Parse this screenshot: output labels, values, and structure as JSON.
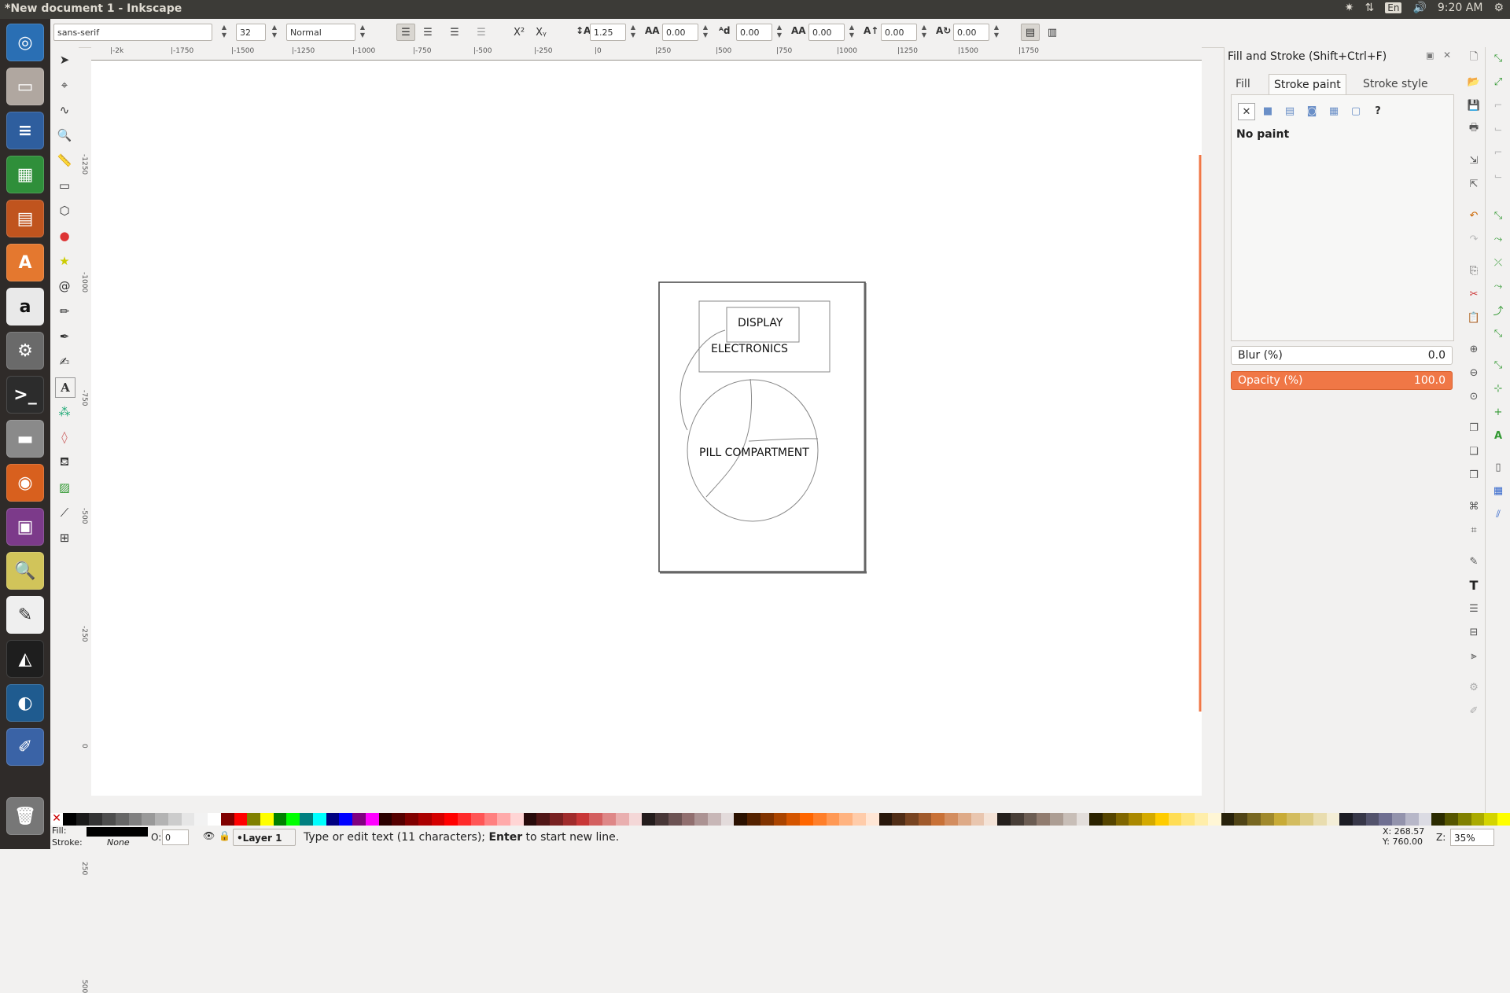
{
  "window": {
    "title": "*New document 1 - Inkscape"
  },
  "tray": {
    "lang": "En",
    "time": "9:20 AM"
  },
  "text_toolbar": {
    "font_family": "sans-serif",
    "font_size": "32",
    "font_style": "Normal",
    "line_spacing": "1.25",
    "letter_spacing": "0.00",
    "word_spacing": "0.00",
    "kerning": "0.00",
    "vertical_shift": "0.00",
    "rotation": "0.00"
  },
  "ruler_labels": [
    "-2k",
    "-1750",
    "-1500",
    "-1250",
    "-1000",
    "-750",
    "-500",
    "-250",
    "0",
    "250",
    "500",
    "750",
    "1000",
    "1250",
    "1500",
    "1750"
  ],
  "vruler_labels": [
    "-1250",
    "-1000",
    "-750",
    "-500",
    "-250",
    "0",
    "250",
    "500"
  ],
  "drawing": {
    "labels": {
      "display": "DISPLAY",
      "electronics": "ELECTRONICS",
      "pill": "PILL COMPARTMENT"
    }
  },
  "dialog": {
    "title": "Fill and Stroke (Shift+Ctrl+F)",
    "tabs": [
      "Fill",
      "Stroke paint",
      "Stroke style"
    ],
    "paint_status": "No paint",
    "blur_label": "Blur (%)",
    "blur_value": "0.0",
    "opacity_label": "Opacity (%)",
    "opacity_value": "100.0"
  },
  "status": {
    "fill_label": "Fill:",
    "stroke_label": "Stroke:",
    "stroke_value": "None",
    "opacity_label": "O:",
    "opacity_value": "0",
    "layer": "•Layer 1",
    "message_pre": "Type or edit text (11 characters); ",
    "message_bold": "Enter",
    "message_post": " to start new line.",
    "x": "X: 268.57",
    "y": "Y: 760.00",
    "zoom_label": "Z:",
    "zoom": "35%"
  },
  "colors": {
    "accent": "#f07746",
    "palette": [
      "#000000",
      "#1a1a1a",
      "#333333",
      "#4d4d4d",
      "#666666",
      "#808080",
      "#999999",
      "#b3b3b3",
      "#cccccc",
      "#e6e6e6",
      "#f2f2f2",
      "#ffffff",
      "#800000",
      "#ff0000",
      "#808000",
      "#ffff00",
      "#008000",
      "#00ff00",
      "#008080",
      "#00ffff",
      "#000080",
      "#0000ff",
      "#800080",
      "#ff00ff",
      "#2b0000",
      "#550000",
      "#800000",
      "#aa0000",
      "#d40000",
      "#ff0000",
      "#ff2a2a",
      "#ff5555",
      "#ff8080",
      "#ffaaaa",
      "#ffd5d5",
      "#280b0b",
      "#501616",
      "#782121",
      "#a02c2c",
      "#c83737",
      "#d35f5f",
      "#de8787",
      "#e9afaf",
      "#f4d7d7",
      "#241c1c",
      "#483737",
      "#6c5353",
      "#916f6f",
      "#ac9393",
      "#c8b7b7",
      "#e3dbdb",
      "#2b1100",
      "#552200",
      "#803300",
      "#aa4400",
      "#d45500",
      "#ff6600",
      "#ff7f2a",
      "#ff9955",
      "#ffb380",
      "#ffccaa",
      "#ffe6d5",
      "#28170b",
      "#502d16",
      "#784421",
      "#a05a2c",
      "#c87137",
      "#d38d5f",
      "#deaa87",
      "#e9c6af",
      "#f4e3d7",
      "#241f1c",
      "#483e37",
      "#6c5d53",
      "#917c6f",
      "#ac9d93",
      "#c8beb7",
      "#e3dedb",
      "#2b2200",
      "#554400",
      "#806600",
      "#aa8800",
      "#d4aa00",
      "#ffcc00",
      "#ffdd55",
      "#ffe680",
      "#ffeeaa",
      "#fff6d5",
      "#28220b",
      "#504416",
      "#786721",
      "#a0892c",
      "#c8ab37",
      "#d3bc5f",
      "#decd87",
      "#e9ddaf",
      "#f4eed7",
      "#1c1c24",
      "#373748",
      "#53536c",
      "#6f6f91",
      "#9393ac",
      "#b7b7c8",
      "#dbdbe3",
      "#2b2b00",
      "#555500",
      "#808000",
      "#aaaa00",
      "#d4d400",
      "#ffff00"
    ]
  }
}
